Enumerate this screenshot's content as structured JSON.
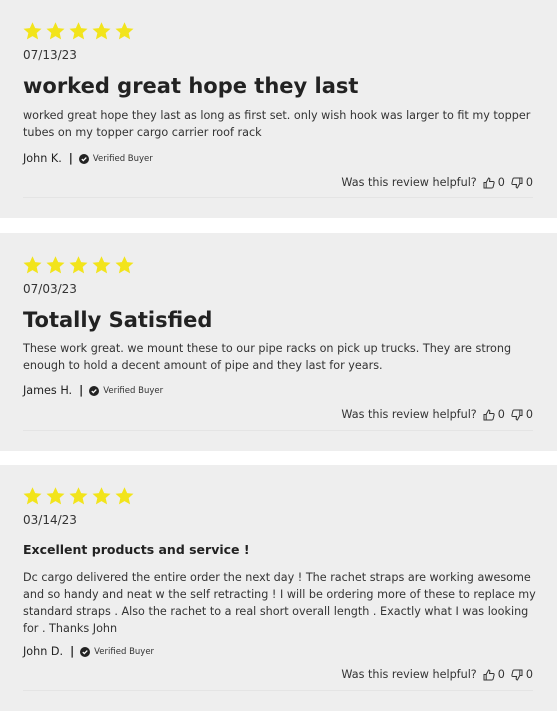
{
  "colors": {
    "star": "#f2e41b",
    "card_bg": "#eeeeee"
  },
  "reviews": [
    {
      "rating": 5,
      "date": "07/13/23",
      "title": "worked great hope they last",
      "body": "worked great hope they last as long as first set. only wish hook was larger to fit my topper tubes on my topper cargo carrier roof rack",
      "author": "John K.",
      "separator": "|",
      "verified": "Verified Buyer",
      "helpful_label": "Was this review helpful?",
      "up_count": "0",
      "down_count": "0"
    },
    {
      "rating": 5,
      "date": "07/03/23",
      "title": "Totally Satisfied",
      "body": "These work great. we mount these to our pipe racks on pick up trucks. They are strong enough to hold a decent amount of pipe and they last for years.",
      "author": "James H.",
      "separator": "|",
      "verified": "Verified Buyer",
      "helpful_label": "Was this review helpful?",
      "up_count": "0",
      "down_count": "0"
    },
    {
      "rating": 5,
      "date": "03/14/23",
      "title": "Excellent products and service !",
      "body": "Dc cargo delivered the entire order the next day ! The rachet straps are working awesome and so handy and neat w the self retracting ! I will be ordering more of these to replace my standard straps . Also the rachet to a real short overall length . Exactly what I was looking for . Thanks John",
      "author": "John D.",
      "separator": "|",
      "verified": "Verified Buyer",
      "helpful_label": "Was this review helpful?",
      "up_count": "0",
      "down_count": "0"
    }
  ]
}
